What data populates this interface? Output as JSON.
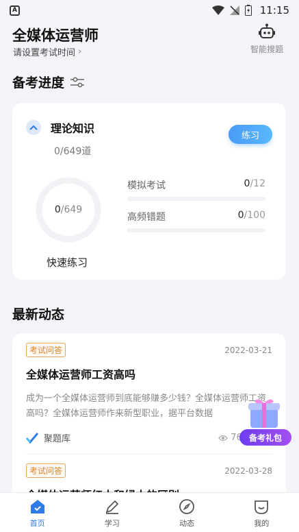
{
  "status_bar": {
    "time": "11:15",
    "left_badge": "A"
  },
  "header": {
    "title": "全媒体运营师",
    "subtitle": "请设置考试时间",
    "smart_search_label": "智能搜题"
  },
  "progress": {
    "section_title": "备考进度",
    "subject": "理论知识",
    "count_text": "0/649道",
    "practice_button": "练习",
    "ring": {
      "done": "0",
      "total": "/649",
      "fraction": 0
    },
    "quick_practice": "快速练习",
    "stats": [
      {
        "label": "模拟考试",
        "done": "0",
        "total": "/12",
        "fraction": 0
      },
      {
        "label": "高频错题",
        "done": "0",
        "total": "/100",
        "fraction": 0
      }
    ]
  },
  "news": {
    "section_title": "最新动态",
    "items": [
      {
        "tag": "考试问答",
        "date": "2022-03-21",
        "title": "全媒体运营师工资高吗",
        "desc": "成为一个全媒体运营师到底能够赚多少钱？全媒体运营师工资高吗？全媒体运营师作来新型职业，据平台数据",
        "source": "聚题库",
        "views": "766"
      },
      {
        "tag": "考试问答",
        "date": "2022-03-28",
        "title": "全媒体运营师红本和绿本的区别"
      }
    ]
  },
  "gift_badge": "备考礼包",
  "tabbar": {
    "tabs": [
      {
        "label": "首页",
        "active": true
      },
      {
        "label": "学习",
        "active": false
      },
      {
        "label": "动态",
        "active": false
      },
      {
        "label": "我的",
        "active": false
      }
    ]
  },
  "colors": {
    "accent": "#4a9af7",
    "tag": "#e0842c",
    "gift": "#7b42f0"
  }
}
